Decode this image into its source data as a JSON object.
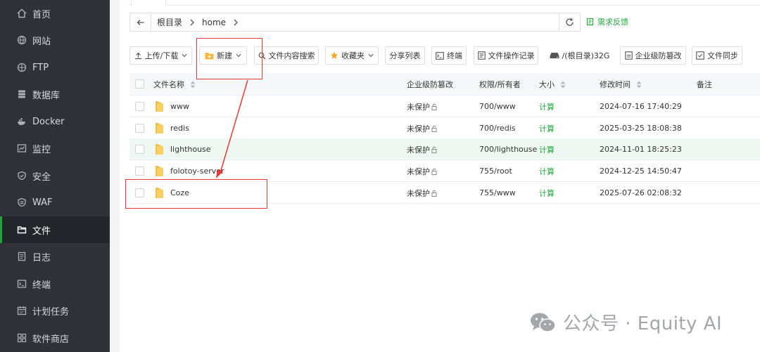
{
  "sidebar": {
    "items": [
      {
        "label": "首页",
        "icon": "home-icon"
      },
      {
        "label": "网站",
        "icon": "globe-icon"
      },
      {
        "label": "FTP",
        "icon": "ftp-globe-icon"
      },
      {
        "label": "数据库",
        "icon": "database-icon"
      },
      {
        "label": "Docker",
        "icon": "docker-icon"
      },
      {
        "label": "监控",
        "icon": "monitor-icon"
      },
      {
        "label": "安全",
        "icon": "shield-icon"
      },
      {
        "label": "WAF",
        "icon": "waf-shield-icon"
      },
      {
        "label": "文件",
        "icon": "folder-icon",
        "active": true
      },
      {
        "label": "日志",
        "icon": "log-icon"
      },
      {
        "label": "终端",
        "icon": "terminal-icon"
      },
      {
        "label": "计划任务",
        "icon": "calendar-icon"
      },
      {
        "label": "软件商店",
        "icon": "apps-icon"
      }
    ],
    "accent": "#20a53a"
  },
  "addressbar": {
    "root": "根目录",
    "current": "home",
    "feedback": "需求反馈"
  },
  "toolbar": {
    "upload": "上传/下载",
    "new": "新建",
    "search": "文件内容搜索",
    "favorites": "收藏夹",
    "share": "分享列表",
    "terminal": "终端",
    "oplog": "文件操作记录",
    "disk": "/(根目录)32G",
    "tamper": "企业级防篡改",
    "sync": "文件同步"
  },
  "table": {
    "headers": {
      "name": "文件名称",
      "tamper": "企业级防篡改",
      "perm": "权限/所有者",
      "size": "大小",
      "mtime": "修改时间",
      "note": "备注"
    },
    "rows": [
      {
        "name": "www",
        "tamper": "未保护",
        "perm": "700/www",
        "size": "计算",
        "mtime": "2024-07-16 17:40:29"
      },
      {
        "name": "redis",
        "tamper": "未保护",
        "perm": "700/redis",
        "size": "计算",
        "mtime": "2025-03-25 18:08:38"
      },
      {
        "name": "lighthouse",
        "tamper": "未保护",
        "perm": "700/lighthouse",
        "size": "计算",
        "mtime": "2024-11-01 18:25:23"
      },
      {
        "name": "folotoy-server",
        "tamper": "未保护",
        "perm": "755/root",
        "size": "计算",
        "mtime": "2024-12-25 14:50:47"
      },
      {
        "name": "Coze",
        "tamper": "未保护",
        "perm": "755/www",
        "size": "计算",
        "mtime": "2025-07-26 02:08:32"
      }
    ]
  },
  "watermark": {
    "text": "公众号 · Equity AI"
  }
}
